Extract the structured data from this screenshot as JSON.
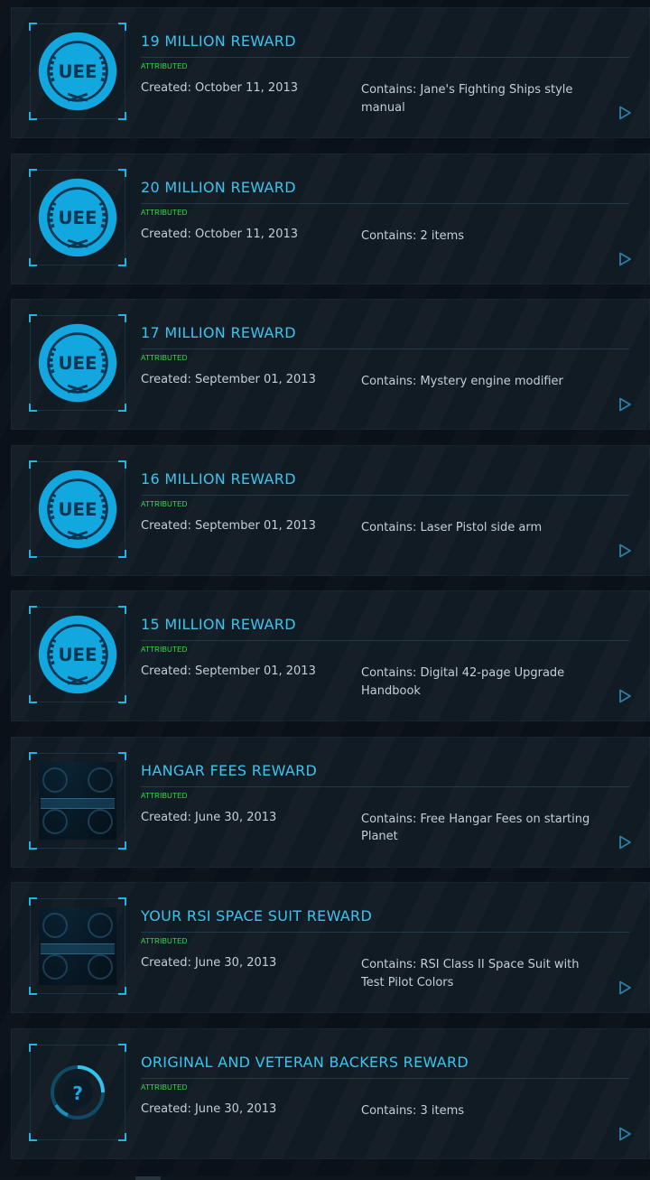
{
  "colors": {
    "accent": "#3dc3ee",
    "status": "#33e04a",
    "text": "#c3ced6",
    "card_bg": "#111b24"
  },
  "rewards": [
    {
      "title": "19 MILLION REWARD",
      "status": "ATTRIBUTED",
      "created": "Created: October 11, 2013",
      "contains": "Contains: Jane's Fighting Ships style manual",
      "image": "uee-emblem-icon"
    },
    {
      "title": "20 MILLION REWARD",
      "status": "ATTRIBUTED",
      "created": "Created: October 11, 2013",
      "contains": "Contains: 2 items",
      "image": "uee-emblem-icon"
    },
    {
      "title": "17 MILLION REWARD",
      "status": "ATTRIBUTED",
      "created": "Created: September 01, 2013",
      "contains": "Contains: Mystery engine modifier",
      "image": "uee-emblem-icon"
    },
    {
      "title": "16 MILLION REWARD",
      "status": "ATTRIBUTED",
      "created": "Created: September 01, 2013",
      "contains": "Contains: Laser Pistol side arm",
      "image": "uee-emblem-icon"
    },
    {
      "title": "15 MILLION REWARD",
      "status": "ATTRIBUTED",
      "created": "Created: September 01, 2013",
      "contains": "Contains: Digital 42-page Upgrade Handbook",
      "image": "uee-emblem-icon"
    },
    {
      "title": "HANGAR FEES REWARD",
      "status": "ATTRIBUTED",
      "created": "Created: June 30, 2013",
      "contains": "Contains: Free Hangar Fees on starting Planet",
      "image": "hangar-image"
    },
    {
      "title": "YOUR RSI SPACE SUIT REWARD",
      "status": "ATTRIBUTED",
      "created": "Created: June 30, 2013",
      "contains": "Contains: RSI Class II Space Suit with Test Pilot Colors",
      "image": "hangar-image"
    },
    {
      "title": "ORIGINAL AND VETERAN BACKERS REWARD",
      "status": "ATTRIBUTED",
      "created": "Created: June 30, 2013",
      "contains": "Contains: 3 items",
      "image": "mystery-icon"
    }
  ]
}
